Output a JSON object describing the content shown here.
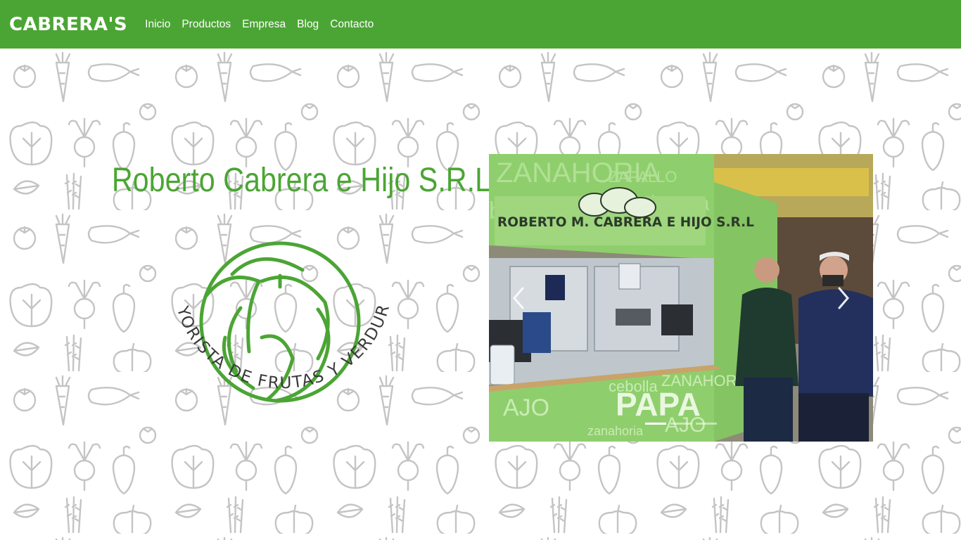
{
  "nav": {
    "brand": "CABRERA'S",
    "links": [
      "Inicio",
      "Productos",
      "Empresa",
      "Blog",
      "Contacto"
    ]
  },
  "hero": {
    "title": "Roberto Cabrera e Hijo S.R.L",
    "logo_ring_text": "MAYORISTA DE FRUTAS Y VERDURAS"
  },
  "carousel": {
    "store_sign": "ROBERTO M. CABRERA E HIJO S.R.L",
    "counter_word": "PAPA",
    "wall_words": [
      "ZANAHORIA",
      "ZAPALLO",
      "batata",
      "cebolla",
      "AJO",
      "zanahoria",
      "PAPA"
    ],
    "slide_count": 3,
    "active_slide": 1
  },
  "colors": {
    "brand_green": "#4ba534",
    "nav_text": "#ffffff",
    "pattern_gray": "#c9c9c9",
    "logo_ring_text": "#3a3a3a"
  }
}
